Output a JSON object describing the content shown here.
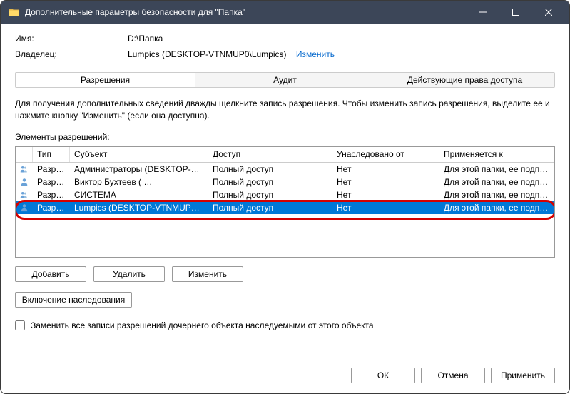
{
  "window_title": "Дополнительные параметры безопасности  для \"Папка\"",
  "info": {
    "name_label": "Имя:",
    "name_value": "D:\\Папка",
    "owner_label": "Владелец:",
    "owner_value": "Lumpics (DESKTOP-VTNMUP0\\Lumpics)",
    "change_link": "Изменить"
  },
  "tabs": {
    "permissions": "Разрешения",
    "audit": "Аудит",
    "effective": "Действующие права доступа"
  },
  "description": "Для получения дополнительных сведений дважды щелкните запись разрешения. Чтобы изменить запись разрешения, выделите ее и нажмите кнопку \"Изменить\" (если она доступна).",
  "section_label": "Элементы разрешений:",
  "columns": {
    "type": "Тип",
    "subject": "Субъект",
    "access": "Доступ",
    "inherited": "Унаследовано от",
    "applies": "Применяется к"
  },
  "rows": [
    {
      "icon": "group",
      "type": "Разр…",
      "subject": "Администраторы (DESKTOP-…",
      "access": "Полный доступ",
      "inherited": "Нет",
      "applies": "Для этой папки, ее подпапок …",
      "selected": false
    },
    {
      "icon": "user",
      "type": "Разр…",
      "subject": "Виктор Бухтеев (                      …",
      "access": "Полный доступ",
      "inherited": "Нет",
      "applies": "Для этой папки, ее подпапок …",
      "selected": false
    },
    {
      "icon": "group",
      "type": "Разр…",
      "subject": "СИСТЕМА",
      "access": "Полный доступ",
      "inherited": "Нет",
      "applies": "Для этой папки, ее подпапок …",
      "selected": false
    },
    {
      "icon": "user",
      "type": "Разр…",
      "subject": "Lumpics (DESKTOP-VTNMUP…",
      "access": "Полный доступ",
      "inherited": "Нет",
      "applies": "Для этой папки, ее подпапок …",
      "selected": true
    }
  ],
  "buttons": {
    "add": "Добавить",
    "remove": "Удалить",
    "edit": "Изменить",
    "enable_inherit": "Включение наследования"
  },
  "checkbox_label": "Заменить все записи разрешений дочернего объекта наследуемыми от этого объекта",
  "footer": {
    "ok": "ОК",
    "cancel": "Отмена",
    "apply": "Применить"
  }
}
